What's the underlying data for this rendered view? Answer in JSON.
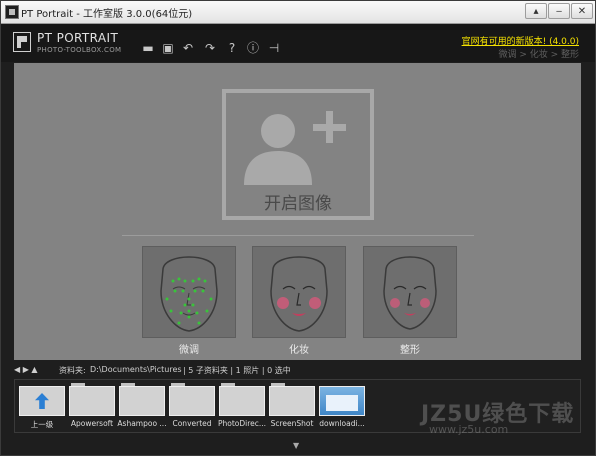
{
  "window": {
    "title": "PT Portrait - 工作室版 3.0.0(64位元)"
  },
  "window_buttons": {
    "collapse": "▴",
    "minimize": "‒",
    "close": "✕"
  },
  "logo": {
    "title": "PT PORTRAIT",
    "subtitle": "PHOTO-TOOLBOX.COM"
  },
  "toolbar": [
    {
      "icon": "folder-open-icon",
      "glyph": "▬"
    },
    {
      "icon": "save-icon",
      "glyph": "▣"
    },
    {
      "icon": "undo-icon",
      "glyph": "↶"
    },
    {
      "icon": "redo-icon",
      "glyph": "↷"
    },
    {
      "icon": "help-icon",
      "glyph": "?"
    },
    {
      "icon": "info-icon",
      "glyph": "ⓘ"
    },
    {
      "icon": "plugin-icon",
      "glyph": "⊣"
    }
  ],
  "header": {
    "update_link": "官网有可用的新版本! (4.0.0)",
    "breadcrumb": "微调 > 化妆 > 整形"
  },
  "main": {
    "open_image_label": "开启图像",
    "modes": [
      {
        "label": "微调"
      },
      {
        "label": "化妆"
      },
      {
        "label": "整形"
      }
    ]
  },
  "pathbar": {
    "nav_icons": "◀ ▶ ▲",
    "folder_label": "资料夹:",
    "folder_path": "D:\\Documents\\Pictures",
    "status": "| 5 子资料夹 | 1 照片 | 0 选中"
  },
  "strip": {
    "items": [
      {
        "label": "上一级",
        "kind": "up"
      },
      {
        "label": "Apowersoft",
        "kind": "folder"
      },
      {
        "label": "Ashampoo ...",
        "kind": "folder"
      },
      {
        "label": "Converted",
        "kind": "folder"
      },
      {
        "label": "PhotoDirec...",
        "kind": "folder"
      },
      {
        "label": "ScreenShot",
        "kind": "folder"
      },
      {
        "label": "downloadi...",
        "kind": "photo"
      }
    ]
  },
  "colors": {
    "accent_link": "#f5e200",
    "canvas": "#838383",
    "background": "#1e1e1e"
  },
  "watermark": {
    "line1": "JZ5U绿色下载",
    "line2": "www.jz5u.com"
  }
}
